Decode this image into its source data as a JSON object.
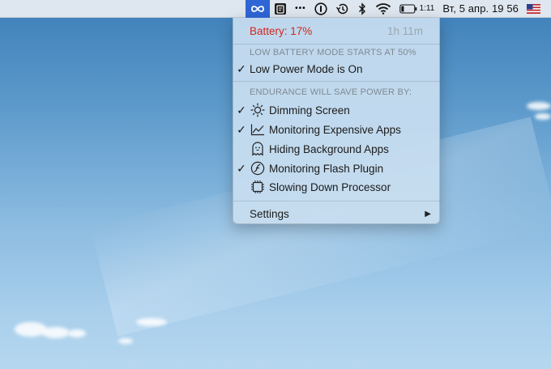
{
  "menubar": {
    "infinity_icon": "infinity-icon",
    "app_icon": "app-icon",
    "more_label": "•••",
    "battery_time": "1:11",
    "date_time": "Вт, 5 апр. 19 56"
  },
  "menu": {
    "battery_label": "Battery: 17%",
    "battery_remaining": "1h 11m",
    "low_battery_header": "LOW BATTERY MODE STARTS AT 50%",
    "low_power_mode": "Low Power Mode is On",
    "endurance_header": "ENDURANCE WILL SAVE POWER BY:",
    "items": [
      {
        "label": "Dimming Screen",
        "checked": true,
        "icon": "sun-icon"
      },
      {
        "label": "Monitoring Expensive Apps",
        "checked": true,
        "icon": "chart-icon"
      },
      {
        "label": "Hiding Background Apps",
        "checked": false,
        "icon": "ghost-icon"
      },
      {
        "label": "Monitoring Flash Plugin",
        "checked": true,
        "icon": "flash-icon"
      },
      {
        "label": "Slowing Down Processor",
        "checked": false,
        "icon": "cpu-icon"
      }
    ],
    "settings_label": "Settings",
    "check_mark": "✓",
    "submenu_arrow": "▶"
  },
  "colors": {
    "battery_red": "#d0281e",
    "highlight_blue": "#2e66d6"
  }
}
